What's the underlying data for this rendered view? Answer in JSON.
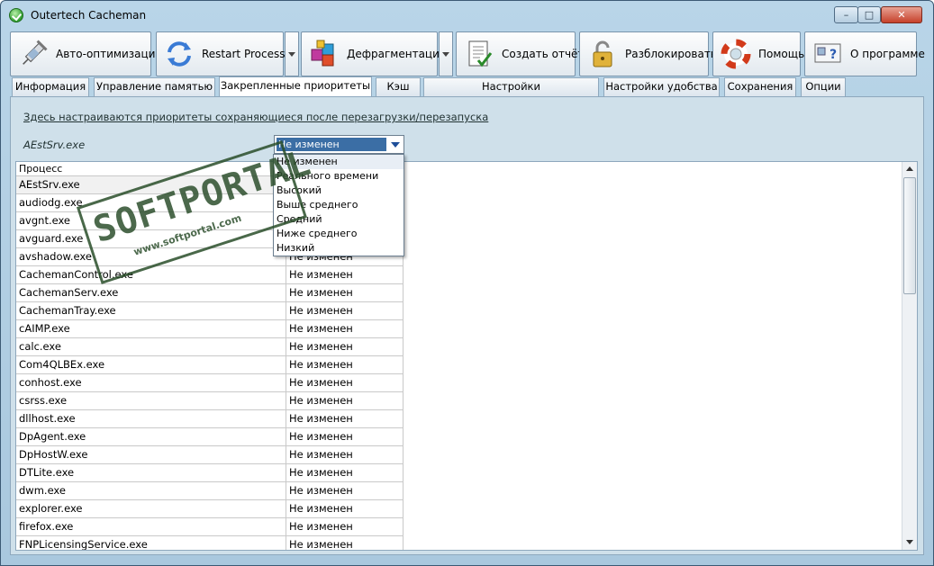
{
  "window": {
    "title": "Outertech Cacheman"
  },
  "toolbar": {
    "buttons": [
      {
        "label": "Авто-оптимизация",
        "icon": "syringe-icon"
      },
      {
        "label": "Restart Process",
        "icon": "restart-arrows-icon"
      },
      {
        "label": "Дефрагментация",
        "icon": "blocks-icon"
      },
      {
        "label": "Создать отчёт",
        "icon": "report-icon"
      },
      {
        "label": "Разблокировать",
        "icon": "padlock-icon"
      },
      {
        "label": "Помощь",
        "icon": "lifebuoy-icon"
      },
      {
        "label": "О программе",
        "icon": "about-icon"
      }
    ]
  },
  "tabs": [
    "Информация",
    "Управление памятью",
    "Закрепленные приоритеты",
    "Кэш",
    "Настройки производительности",
    "Настройки удобства",
    "Сохранения",
    "Опции"
  ],
  "panel": {
    "hint": "Здесь настраиваются приоритеты сохраняющиеся после перезагрузки/перезапуска",
    "selected_process": "AEstSrv.exe",
    "combo_value": "Не изменен"
  },
  "grid": {
    "header": "Процесс",
    "rows": [
      {
        "process": "AEstSrv.exe",
        "priority": ""
      },
      {
        "process": "audiodg.exe",
        "priority": ""
      },
      {
        "process": "avgnt.exe",
        "priority": ""
      },
      {
        "process": "avguard.exe",
        "priority": ""
      },
      {
        "process": "avshadow.exe",
        "priority": "Не изменен"
      },
      {
        "process": "CachemanControl.exe",
        "priority": "Не изменен"
      },
      {
        "process": "CachemanServ.exe",
        "priority": "Не изменен"
      },
      {
        "process": "CachemanTray.exe",
        "priority": "Не изменен"
      },
      {
        "process": "cAIMP.exe",
        "priority": "Не изменен"
      },
      {
        "process": "calc.exe",
        "priority": "Не изменен"
      },
      {
        "process": "Com4QLBEx.exe",
        "priority": "Не изменен"
      },
      {
        "process": "conhost.exe",
        "priority": "Не изменен"
      },
      {
        "process": "csrss.exe",
        "priority": "Не изменен"
      },
      {
        "process": "dllhost.exe",
        "priority": "Не изменен"
      },
      {
        "process": "DpAgent.exe",
        "priority": "Не изменен"
      },
      {
        "process": "DpHostW.exe",
        "priority": "Не изменен"
      },
      {
        "process": "DTLite.exe",
        "priority": "Не изменен"
      },
      {
        "process": "dwm.exe",
        "priority": "Не изменен"
      },
      {
        "process": "explorer.exe",
        "priority": "Не изменен"
      },
      {
        "process": "firefox.exe",
        "priority": "Не изменен"
      },
      {
        "process": "FNPLicensingService.exe",
        "priority": "Не изменен"
      }
    ]
  },
  "dropdown": {
    "options": [
      "Не изменен",
      "Реального времени",
      "Высокий",
      "Выше среднего",
      "Средний",
      "Ниже среднего",
      "Низкий"
    ]
  },
  "watermark": {
    "main": "SOFTPORTAL",
    "url": "www.softportal.com"
  }
}
